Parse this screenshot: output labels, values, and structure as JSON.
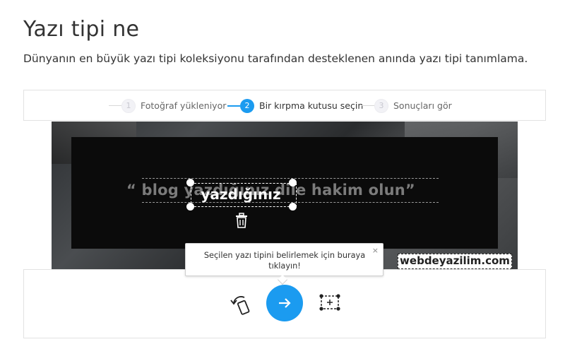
{
  "page": {
    "title": "Yazı tipi ne",
    "subtitle": "Dünyanın en büyük yazı tipi koleksiyonu tarafından desteklenen anında yazı tipi tanımlama."
  },
  "stepper": {
    "steps": [
      {
        "number": "1",
        "label": "Fotoğraf yükleniyor",
        "state": "inactive"
      },
      {
        "number": "2",
        "label": "Bir kırpma kutusu seçin",
        "state": "active"
      },
      {
        "number": "3",
        "label": "Sonuçları gör",
        "state": "inactive"
      }
    ]
  },
  "image": {
    "quote_text": "“ blog yazdığınız dile hakim olun”",
    "selected_word": "yazdığınız",
    "watermark": "webdeyazilim.com"
  },
  "tooltip": {
    "text": "Seçilen yazı tipini belirlemek için buraya tıklayın!",
    "close_symbol": "×"
  },
  "toolbar": {
    "rotate_icon": "rotate-icon",
    "next_icon": "arrow-right-icon",
    "select_icon": "crop-select-icon"
  },
  "colors": {
    "accent": "#1b9bf0",
    "dark_box": "#0b0b0b"
  }
}
